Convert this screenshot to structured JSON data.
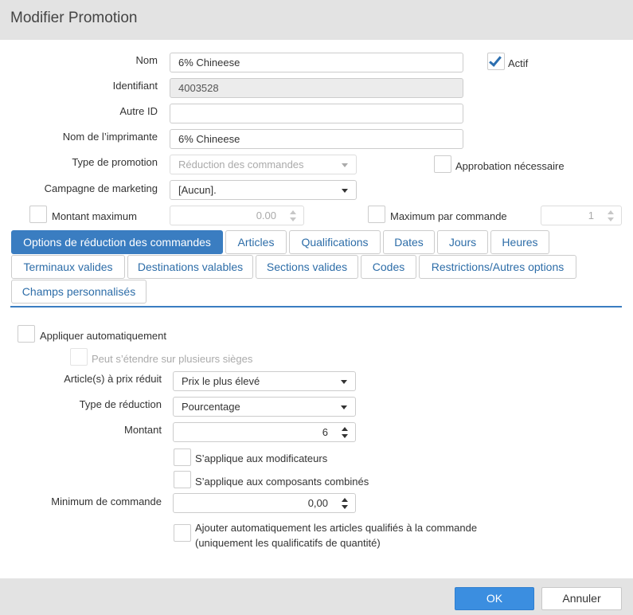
{
  "window": {
    "title": "Modifier Promotion"
  },
  "form": {
    "name_label": "Nom",
    "name_value": "6% Chineese",
    "active_label": "Actif",
    "active_checked": true,
    "id_label": "Identifiant",
    "id_value": "4003528",
    "other_id_label": "Autre ID",
    "other_id_value": "",
    "printer_name_label": "Nom de l’imprimante",
    "printer_name_value": "6% Chineese",
    "promo_type_label": "Type de promotion",
    "promo_type_value": "Réduction des commandes",
    "approval_label": "Approbation nécessaire",
    "campaign_label": "Campagne de marketing",
    "campaign_value": "[Aucun].",
    "max_amount_label": "Montant maximum",
    "max_amount_value": "0.00",
    "max_per_order_label": "Maximum par commande",
    "max_per_order_value": "1"
  },
  "tabs": [
    {
      "label": "Options de réduction des commandes",
      "active": true
    },
    {
      "label": "Articles"
    },
    {
      "label": "Qualifications"
    },
    {
      "label": "Dates"
    },
    {
      "label": "Jours"
    },
    {
      "label": "Heures"
    },
    {
      "label": "Terminaux valides"
    },
    {
      "label": "Destinations valables"
    },
    {
      "label": "Sections valides"
    },
    {
      "label": "Codes"
    },
    {
      "label": "Restrictions/Autres options"
    },
    {
      "label": "Champs personnalisés"
    }
  ],
  "options": {
    "auto_apply_label": "Appliquer automatiquement",
    "multi_seat_label": "Peut s’étendre sur plusieurs sièges",
    "discounted_items_label": "Article(s) à prix réduit",
    "discounted_items_value": "Prix le plus élevé",
    "discount_type_label": "Type de réduction",
    "discount_type_value": "Pourcentage",
    "amount_label": "Montant",
    "amount_value": "6",
    "modifiers_label": "S’applique aux modificateurs",
    "combo_label": "S’applique aux composants combinés",
    "min_order_label": "Minimum de commande",
    "min_order_value": "0,00",
    "auto_add_line1": "Ajouter automatiquement les articles qualifiés à la commande",
    "auto_add_line2": "(uniquement les qualificatifs de quantité)"
  },
  "footer": {
    "ok_label": "OK",
    "cancel_label": "Annuler"
  },
  "colors": {
    "accent": "#3a7dc1",
    "ok_button": "#3b8ee0",
    "header_bg": "#e3e3e3"
  }
}
